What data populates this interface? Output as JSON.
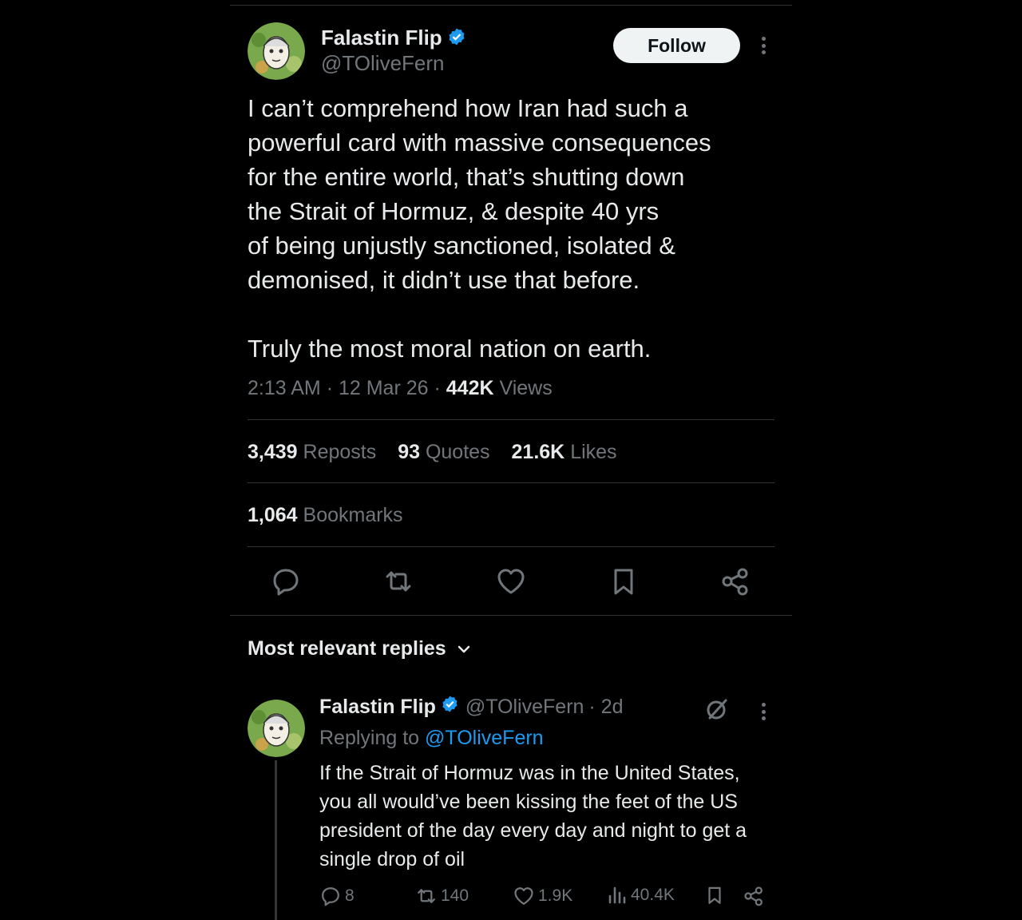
{
  "tweet": {
    "author_name": "Falastin Flip",
    "author_handle": "@TOliveFern",
    "follow_label": "Follow",
    "text": "I can’t comprehend how Iran had such a\npowerful card with massive consequences\nfor the entire world, that’s shutting down\nthe Strait of Hormuz, & despite 40 yrs\nof being unjustly sanctioned, isolated &\ndemonised, it didn’t use that before.\n\nTruly the most moral nation on earth.",
    "time": "2:13 AM",
    "date": "12 Mar 26",
    "views_count": "442K",
    "views_label": "Views",
    "separator": "·",
    "stats": {
      "reposts_count": "3,439",
      "reposts_label": "Reposts",
      "quotes_count": "93",
      "quotes_label": "Quotes",
      "likes_count": "21.6K",
      "likes_label": "Likes",
      "bookmarks_count": "1,064",
      "bookmarks_label": "Bookmarks"
    }
  },
  "replies_section": {
    "sort_label": "Most relevant replies"
  },
  "reply": {
    "author_name": "Falastin Flip",
    "author_handle": "@TOliveFern",
    "age": "· 2d",
    "replying_prefix": "Replying to",
    "replying_handle": "@TOliveFern",
    "text": "If the Strait of Hormuz was in the United States, you all would’ve been kissing the feet of the US president of the day every day and night to get a single drop of oil",
    "replies_count": "8",
    "reposts_count": "140",
    "likes_count": "1.9K",
    "views_count": "40.4K"
  },
  "colors": {
    "background": "#000000",
    "text_primary": "#e7e9ea",
    "text_secondary": "#71767b",
    "accent_blue": "#1d9bf0",
    "divider": "#2f3336"
  },
  "icons": [
    "verified-badge-icon",
    "more-icon",
    "reply-icon",
    "repost-icon",
    "like-icon",
    "bookmark-icon",
    "share-icon",
    "chevron-down-icon",
    "grok-icon",
    "views-icon"
  ]
}
